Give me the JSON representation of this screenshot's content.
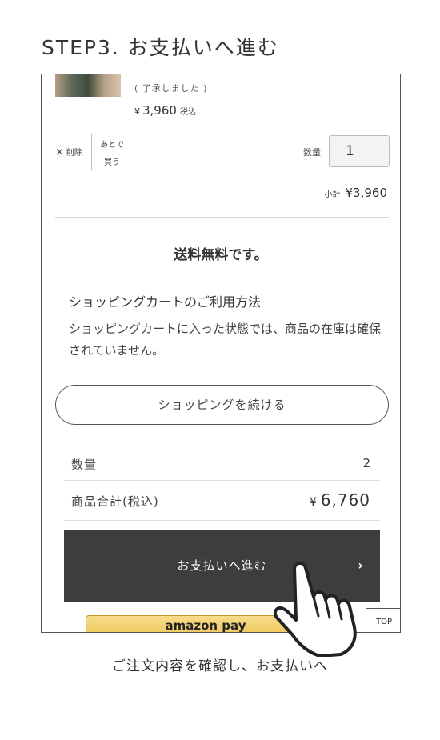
{
  "heading": "STEP3. お支払いへ進む",
  "cart_item": {
    "note": "( 了承しました )",
    "price_yen": "¥",
    "price": "3,960",
    "tax_label": "税込",
    "delete_label": "削除",
    "later_line1": "あとで",
    "later_line2": "買う",
    "qty_label": "数量",
    "qty_value": "1",
    "subtotal_label": "小計",
    "subtotal_value": "¥3,960"
  },
  "free_shipping": "送料無料です。",
  "usage": {
    "title": "ショッピングカートのご利用方法",
    "body": "ショッピングカートに入った状態では、商品の在庫は確保されていません。"
  },
  "continue_label": "ショッピングを続ける",
  "summary": {
    "qty_label": "数量",
    "qty_value": "2",
    "total_label": "商品合計(税込)",
    "total_yen": "¥",
    "total_value": "6,760"
  },
  "checkout_label": "お支払いへ進む",
  "checkout_chevron": "›",
  "amazon_pay_label": "amazon pay",
  "top_label": "TOP",
  "caption": "ご注文内容を確認し、お支払いへ",
  "icons": {
    "thumbnail": "product-thumbnail",
    "close": "close-icon",
    "chevron": "chevron-right-icon",
    "hand": "hand-pointer-icon"
  }
}
